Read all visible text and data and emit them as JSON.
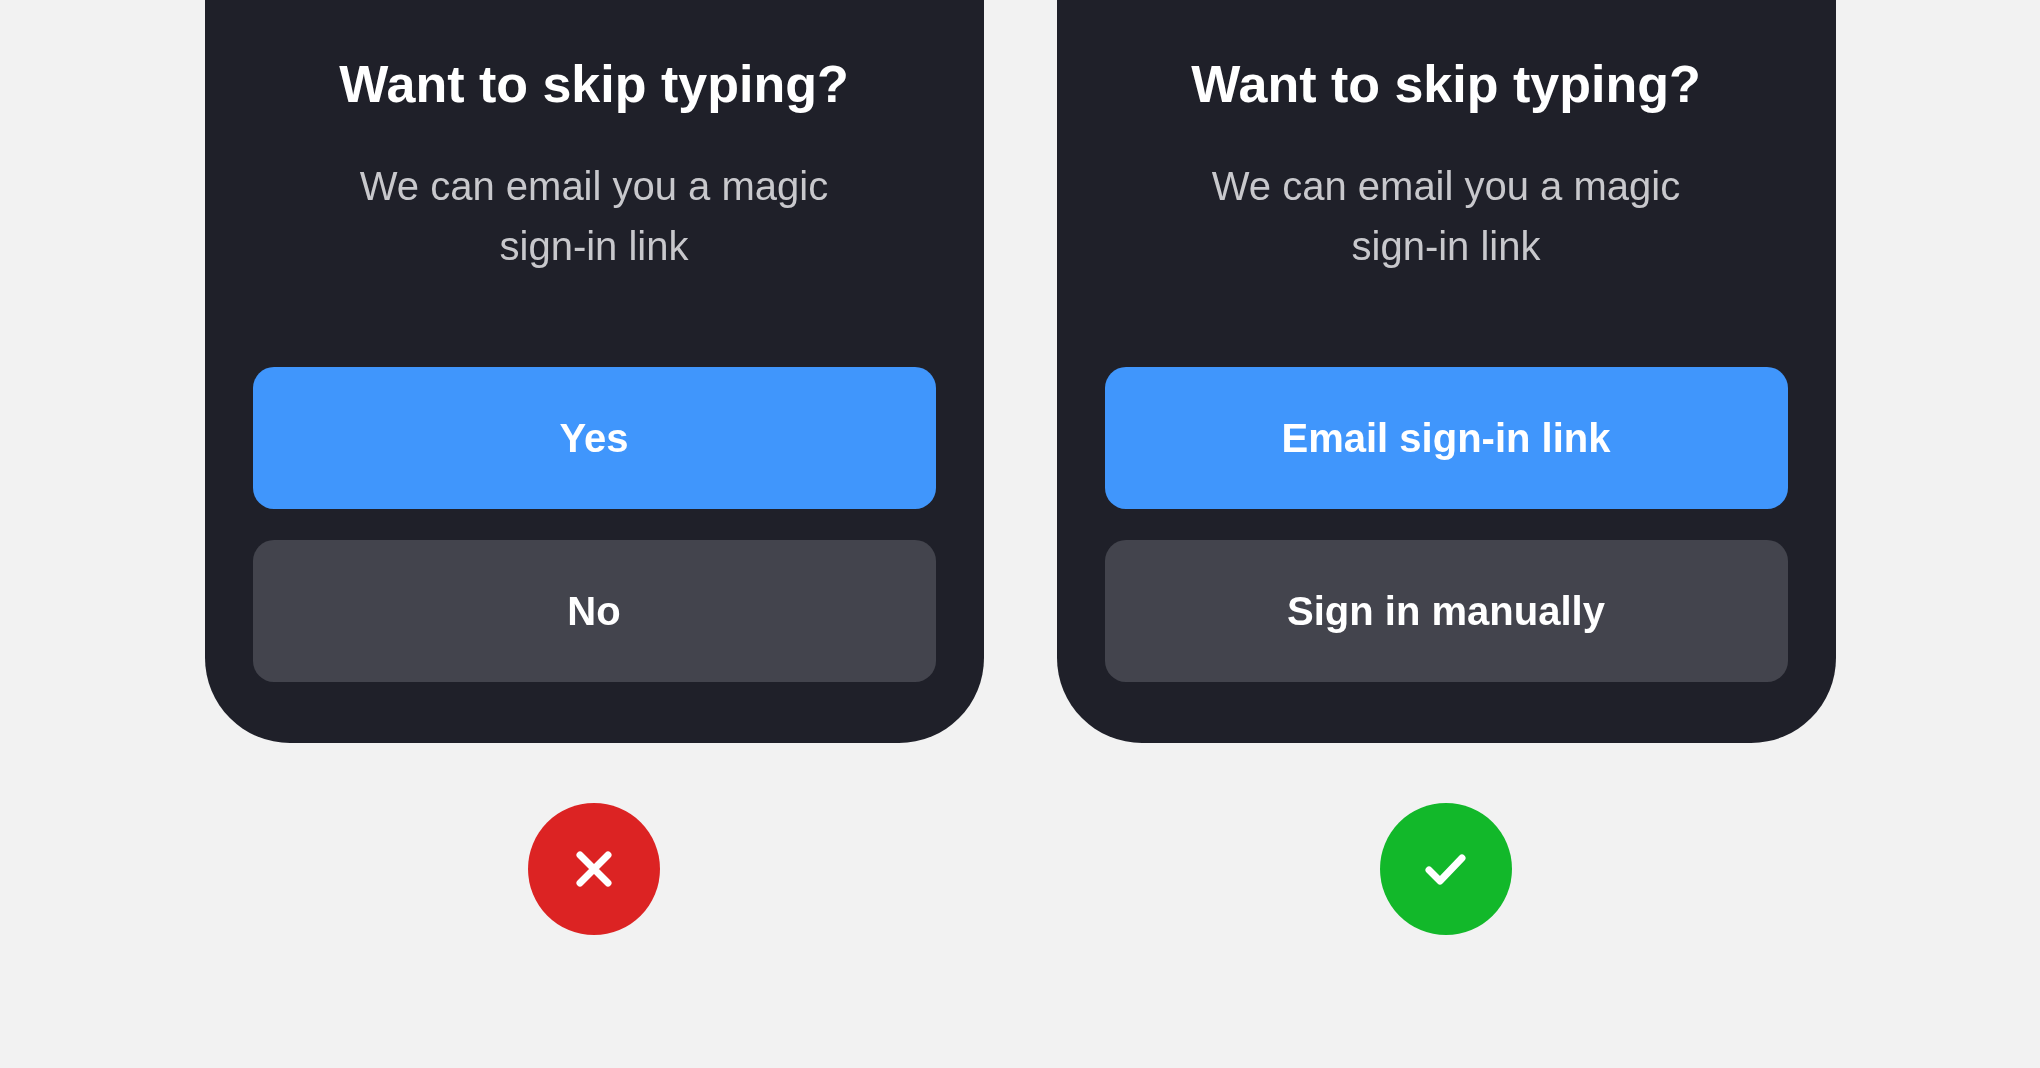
{
  "panels": [
    {
      "kind": "bad",
      "title": "Want to skip typing?",
      "subtitle": "We can email you a magic sign-in link",
      "buttons": [
        {
          "label": "Yes",
          "kind": "primary"
        },
        {
          "label": "No",
          "kind": "secondary"
        }
      ]
    },
    {
      "kind": "good",
      "title": "Want to skip typing?",
      "subtitle": "We can email you a magic sign-in link",
      "buttons": [
        {
          "label": "Email sign-in link",
          "kind": "primary"
        },
        {
          "label": "Sign in manually",
          "kind": "secondary"
        }
      ]
    }
  ]
}
